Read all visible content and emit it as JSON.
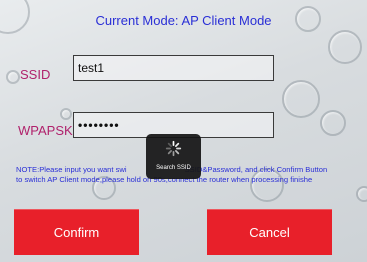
{
  "header": {
    "title": "Current Mode: AP Client Mode"
  },
  "form": {
    "ssid_label": "SSID",
    "ssid_value": "test1",
    "wpapsk_label": "WPAPSK",
    "wpapsk_value": "••••••••"
  },
  "note": {
    "line1_before": "NOTE:Please input you want swi",
    "line1_after": "SSID&Password, and click Confirm Button",
    "line2": "to switch AP Client mode,please hold on 90s,connect the router when processing finishe"
  },
  "loader": {
    "label": "Search SSID",
    "icon": "spinner-icon"
  },
  "buttons": {
    "confirm": "Confirm",
    "cancel": "Cancel"
  },
  "colors": {
    "title": "#2a2fd6",
    "label": "#b0226c",
    "button": "#e8202a"
  }
}
